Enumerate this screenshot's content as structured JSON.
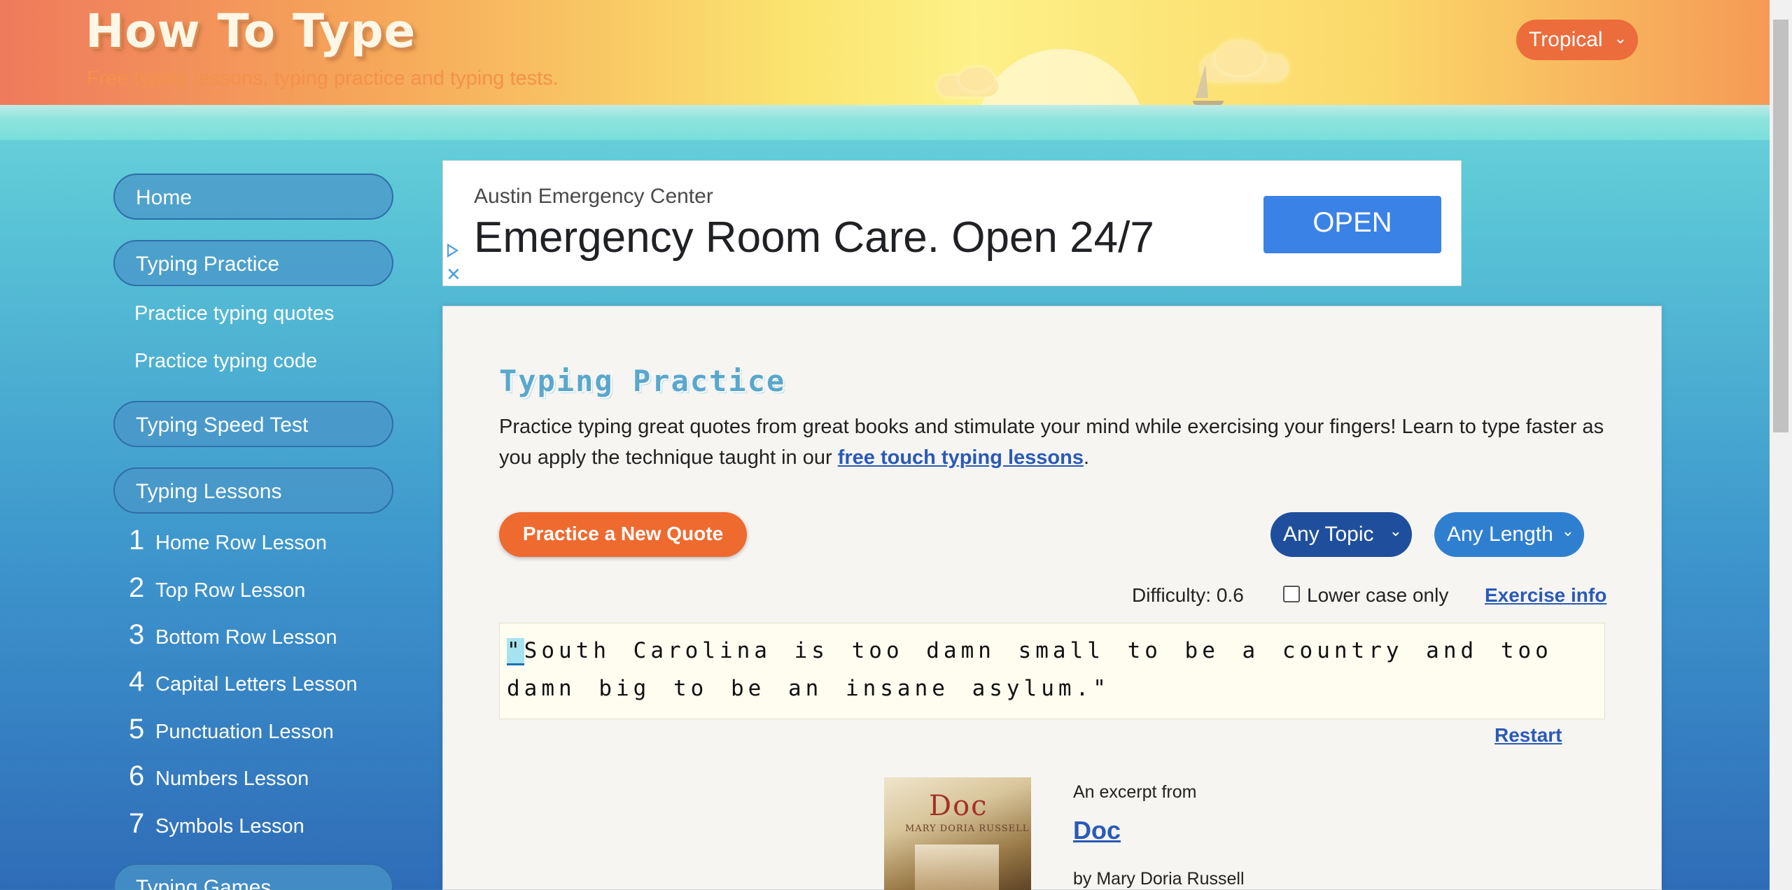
{
  "header": {
    "site_title": "How To Type",
    "tagline": "Free typing lessons, typing practice and typing tests.",
    "theme_select": "Tropical"
  },
  "sidebar": {
    "home": "Home",
    "typing_practice": "Typing Practice",
    "practice_quotes": "Practice typing quotes",
    "practice_code": "Practice typing code",
    "speed_test": "Typing Speed Test",
    "typing_lessons": "Typing Lessons",
    "lessons": [
      {
        "num": "1",
        "label": "Home Row Lesson"
      },
      {
        "num": "2",
        "label": "Top Row Lesson"
      },
      {
        "num": "3",
        "label": "Bottom Row Lesson"
      },
      {
        "num": "4",
        "label": "Capital Letters Lesson"
      },
      {
        "num": "5",
        "label": "Punctuation Lesson"
      },
      {
        "num": "6",
        "label": "Numbers Lesson"
      },
      {
        "num": "7",
        "label": "Symbols Lesson"
      }
    ],
    "typing_games": "Typing Games"
  },
  "ad": {
    "advertiser": "Austin Emergency Center",
    "headline": "Emergency Room Care. Open 24/7",
    "button": "OPEN"
  },
  "main": {
    "title": "Typing Practice",
    "intro_text": "Practice typing great quotes from great books and stimulate your mind while exercising your fingers! Learn to type faster as you apply the technique taught in our ",
    "intro_link": "free touch typing lessons",
    "intro_end": ".",
    "new_quote_button": "Practice a New Quote",
    "topic_select": "Any Topic",
    "length_select": "Any Length",
    "difficulty": "Difficulty: 0.6",
    "lowercase_label": "Lower case only",
    "exercise_info": "Exercise info",
    "quote_first_char": "\"",
    "quote_rest": "South Carolina is too damn small to be a country and too damn big to be an insane asylum.\"",
    "restart": "Restart",
    "excerpt_label": "An excerpt from",
    "book_title": "Doc",
    "book_author": "by Mary Doria Russell",
    "cover_title": "Doc",
    "cover_author": "MARY DORIA RUSSELL"
  }
}
